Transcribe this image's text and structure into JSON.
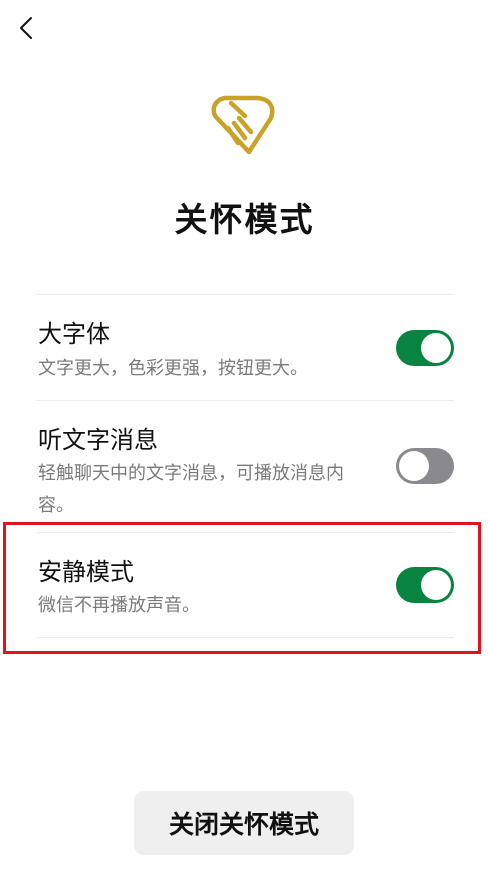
{
  "page": {
    "title": "关怀模式",
    "logo_icon": "care-hand-heart-icon",
    "accent_color": "#c9a227"
  },
  "settings": [
    {
      "title": "大字体",
      "description": "文字更大，色彩更强，按钮更大。",
      "enabled": true
    },
    {
      "title": "听文字消息",
      "description": "轻触聊天中的文字消息，可播放消息内容。",
      "enabled": false
    },
    {
      "title": "安静模式",
      "description": "微信不再播放声音。",
      "enabled": true
    }
  ],
  "colors": {
    "toggle_on": "#07843f",
    "toggle_off": "#8a8a8e",
    "highlight_border": "#e0141e"
  },
  "footer": {
    "close_button_label": "关闭关怀模式"
  }
}
